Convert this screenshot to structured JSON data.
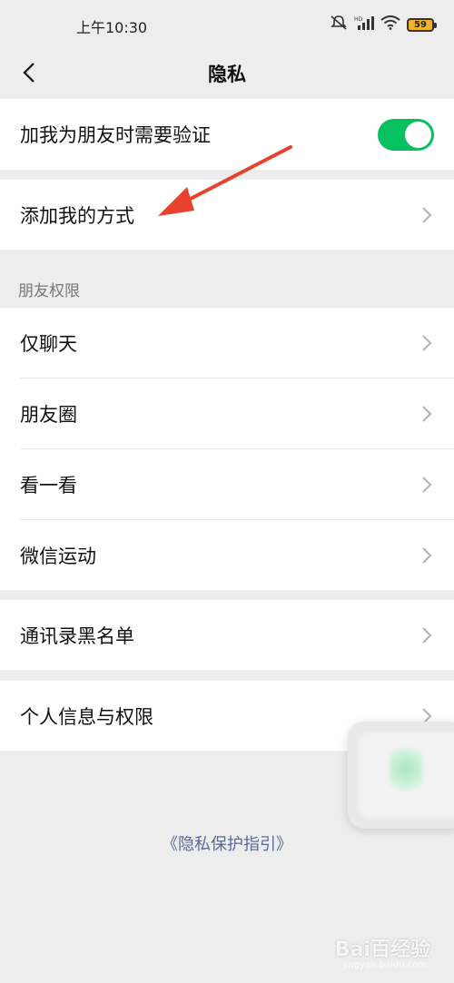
{
  "status_bar": {
    "time": "上午10:30",
    "battery": "59"
  },
  "nav": {
    "title": "隐私"
  },
  "verify": {
    "label": "加我为朋友时需要验证",
    "enabled": true
  },
  "add_methods": {
    "label": "添加我的方式"
  },
  "friend_permissions": {
    "header": "朋友权限",
    "items": [
      {
        "label": "仅聊天"
      },
      {
        "label": "朋友圈"
      },
      {
        "label": "看一看"
      },
      {
        "label": "微信运动"
      }
    ]
  },
  "blacklist": {
    "label": "通讯录黑名单"
  },
  "personal_info": {
    "label": "个人信息与权限"
  },
  "footer": {
    "link": "《隐私保护指引》"
  },
  "watermark": {
    "text": "Bai百经验",
    "sub": "jingyan.baidu.com"
  },
  "colors": {
    "toggle_on": "#07c160",
    "link": "#576b95",
    "arrow": "#e8412c"
  }
}
